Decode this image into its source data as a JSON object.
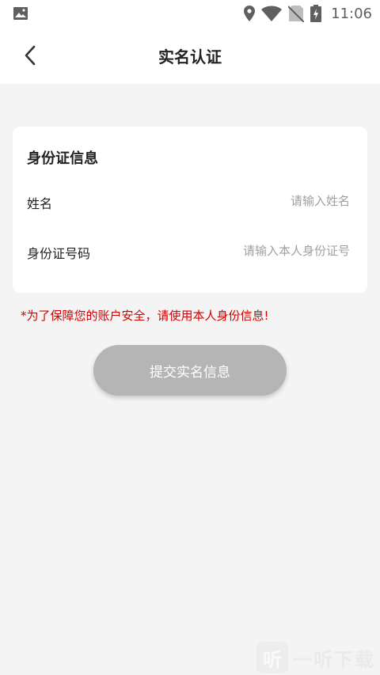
{
  "status_bar": {
    "time": "11:06",
    "icons": [
      "image-icon",
      "location-icon",
      "wifi-icon",
      "no-sim-icon",
      "battery-charging-icon"
    ]
  },
  "header": {
    "title": "实名认证",
    "back_icon": "chevron-left-icon"
  },
  "card": {
    "title": "身份证信息",
    "fields": [
      {
        "label": "姓名",
        "placeholder": "请输入姓名",
        "value": ""
      },
      {
        "label": "身份证号码",
        "placeholder": "请输入本人身份证号",
        "value": ""
      }
    ]
  },
  "warning": "*为了保障您的账户安全，请使用本人身份信息!",
  "submit_label": "提交实名信息",
  "watermark": {
    "logo_char": "听",
    "text": "一听下载"
  },
  "colors": {
    "warning": "#d40000",
    "button_disabled": "#b5b5b5",
    "background": "#f4f4f4"
  }
}
